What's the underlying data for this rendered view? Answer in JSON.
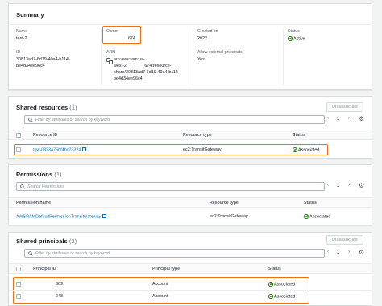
{
  "summary": {
    "title": "Summary",
    "name_label": "Name",
    "name_value": "test-2",
    "id_label": "ID",
    "id_value_1": "30813ad7-6d19-40a4-b114-",
    "id_value_2": "be4d34ee96c4",
    "owner_label": "Owner",
    "owner_value": "674",
    "arn_label": "ARN",
    "arn_value_1": "arn:aws:ram:us-",
    "arn_value_2": "west-2:              674:resource-",
    "arn_value_3": "share/30813ad7-6d19-40a4-b114-",
    "arn_value_4": "be4d34ee96c4",
    "created_label": "Created on",
    "created_value": "2022",
    "external_label": "Allow external principals",
    "external_value": "Yes",
    "status_label": "Status",
    "status_value": "Active"
  },
  "shared_resources": {
    "title": "Shared resources",
    "count": "(1)",
    "disassociate": "Disassociate",
    "search_placeholder": "Filter by attributes or search by keyword",
    "page": "1",
    "headers": [
      "Resource ID",
      "Resource type",
      "Status"
    ],
    "rows": [
      {
        "id": "tgw-0823a75bf4bc73324",
        "type": "ec2:TransitGateway",
        "status": "Associated"
      }
    ]
  },
  "permissions": {
    "title": "Permissions",
    "count": "(1)",
    "search_placeholder": "Search Permissions",
    "page": "1",
    "headers": [
      "Permission name",
      "Resource type",
      "Status"
    ],
    "rows": [
      {
        "name": "AWSRAMDefaultPermissionTransitGateway",
        "type": "ec2:TransitGateway",
        "status": "Associated"
      }
    ]
  },
  "shared_principals": {
    "title": "Shared principals",
    "count": "(2)",
    "disassociate": "Disassociate",
    "search_placeholder": "Filter by attributes or search by keyword",
    "page": "1",
    "headers": [
      "Principal ID",
      "Principal type",
      "Status"
    ],
    "rows": [
      {
        "id": "869",
        "type": "Account",
        "status": "Associated"
      },
      {
        "id": "048",
        "type": "Account",
        "status": "Associated"
      }
    ]
  },
  "colors": {
    "highlight": "#ec7211",
    "link": "#0073bb",
    "success": "#1d8102"
  },
  "icons": {
    "search": "search-icon",
    "external": "external-link-icon",
    "copy": "copy-icon",
    "settings": "gear-icon",
    "status": "status-success-icon"
  }
}
